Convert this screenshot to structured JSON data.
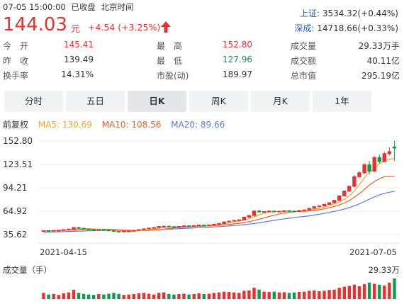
{
  "header": {
    "datetime": "07-05 15:00:00",
    "status": "已收盘",
    "timezone": "北京时间",
    "price": "144.03",
    "unit": "元",
    "change": "+4.54 (+3.25%)",
    "arrow": "up-arrow-icon"
  },
  "indices": [
    {
      "name": "上证:",
      "value": "3534.32(+0.44%)"
    },
    {
      "name": "深成:",
      "value": "14718.66(+0.33%)"
    }
  ],
  "stats": {
    "col1": [
      {
        "label": "今　开",
        "value": "145.41",
        "color": "red"
      },
      {
        "label": "昨　收",
        "value": "139.49",
        "color": "normal"
      },
      {
        "label": "换手率",
        "value": "14.31%",
        "color": "normal"
      }
    ],
    "col2": [
      {
        "label": "最　高",
        "value": "152.80",
        "color": "red"
      },
      {
        "label": "最　低",
        "value": "127.96",
        "color": "green"
      },
      {
        "label": "市盈(动)",
        "value": "189.97",
        "color": "normal"
      }
    ],
    "col3": [
      {
        "label": "成交量",
        "value": "29.33万手",
        "color": "normal"
      },
      {
        "label": "成交额",
        "value": "40.11亿",
        "color": "normal"
      },
      {
        "label": "总市值",
        "value": "295.19亿",
        "color": "normal"
      }
    ]
  },
  "tabs": [
    "分时",
    "五日",
    "日K",
    "周K",
    "月K",
    "1年"
  ],
  "active_tab": "日K",
  "legend": {
    "adjust": "前复权",
    "ma5": "MA5: 130.69",
    "ma10": "MA10: 108.56",
    "ma20": "MA20: 89.66"
  },
  "colors": {
    "up": "#e93030",
    "down": "#0a9d4f",
    "ma5": "#f5a623",
    "ma10": "#ee5d2a",
    "ma20": "#5b7be0"
  },
  "volume": {
    "label": "成交量（手）",
    "max_label": "29.33万"
  },
  "chart_data": {
    "type": "candlestick",
    "y_ticks": [
      "152.80",
      "123.51",
      "94.21",
      "64.92",
      "35.62"
    ],
    "ylim": [
      35.62,
      152.8
    ],
    "x_labels": [
      "2021-04-15",
      "2021-07-05"
    ],
    "candles": [
      [
        40,
        41,
        39,
        40.5
      ],
      [
        40.5,
        41,
        40,
        40.2
      ],
      [
        40.2,
        41,
        40,
        40.8
      ],
      [
        40.8,
        41.5,
        40.5,
        41
      ],
      [
        41,
        42,
        40.8,
        41.8
      ],
      [
        41.8,
        43,
        41.5,
        42.5
      ],
      [
        42.5,
        45,
        42,
        44.5
      ],
      [
        44.5,
        45,
        43,
        43.5
      ],
      [
        43.5,
        44,
        42,
        42.5
      ],
      [
        42.5,
        43,
        41.5,
        42
      ],
      [
        42,
        42.5,
        41,
        41.5
      ],
      [
        41.5,
        42,
        41,
        41.8
      ],
      [
        41.8,
        42,
        41,
        41.2
      ],
      [
        41.2,
        41.5,
        40,
        40.5
      ],
      [
        40.5,
        41,
        39,
        39.5
      ],
      [
        39.5,
        40,
        38.5,
        39
      ],
      [
        39,
        40,
        38.5,
        39.8
      ],
      [
        39.8,
        40.5,
        39,
        40
      ],
      [
        40,
        41,
        39.5,
        40.8
      ],
      [
        40.8,
        42,
        40.5,
        41.8
      ],
      [
        41.8,
        43,
        41.5,
        42.8
      ],
      [
        42.8,
        44,
        42.5,
        43.8
      ],
      [
        43.8,
        45,
        43.5,
        44.5
      ],
      [
        44.5,
        46,
        44,
        45.8
      ],
      [
        45.8,
        47,
        45,
        46
      ],
      [
        46,
        47,
        45,
        45.5
      ],
      [
        45.5,
        46,
        44.5,
        45
      ],
      [
        45,
        46,
        44.5,
        45.8
      ],
      [
        45.8,
        47,
        45.5,
        46.5
      ],
      [
        46.5,
        47,
        45.5,
        46
      ],
      [
        46,
        47,
        45.5,
        46.8
      ],
      [
        46.8,
        48,
        46.5,
        47.5
      ],
      [
        47.5,
        48,
        46.5,
        47
      ],
      [
        47,
        48,
        46.5,
        47.8
      ],
      [
        47.8,
        49,
        47.5,
        48.5
      ],
      [
        48.5,
        50,
        48,
        49.5
      ],
      [
        49.5,
        52,
        49,
        51.5
      ],
      [
        51.5,
        53,
        51,
        52.5
      ],
      [
        52.5,
        54,
        52,
        53.5
      ],
      [
        53.5,
        55,
        53,
        54
      ],
      [
        54,
        58,
        53.5,
        57.5
      ],
      [
        57.5,
        60,
        57,
        59.5
      ],
      [
        59.5,
        66,
        59,
        65
      ],
      [
        65,
        67,
        63,
        64
      ],
      [
        64,
        65,
        63,
        64.5
      ],
      [
        64.5,
        66,
        64,
        65
      ],
      [
        65,
        65.5,
        63.5,
        64
      ],
      [
        64,
        65,
        63.5,
        64.8
      ],
      [
        64.8,
        66,
        64,
        65.5
      ],
      [
        65.5,
        66,
        64.5,
        65
      ],
      [
        65,
        65.5,
        64,
        64.5
      ],
      [
        64.5,
        66,
        64,
        65.8
      ],
      [
        65.8,
        67,
        65,
        66.5
      ],
      [
        66.5,
        69,
        66,
        68.5
      ],
      [
        68.5,
        71,
        68,
        70.5
      ],
      [
        70.5,
        72,
        70,
        71.5
      ],
      [
        71.5,
        74,
        71,
        73.5
      ],
      [
        73.5,
        76,
        73,
        75.5
      ],
      [
        75.5,
        79,
        75,
        78.5
      ],
      [
        78.5,
        85,
        78,
        84
      ],
      [
        84,
        91,
        83.5,
        90
      ],
      [
        90,
        97,
        89,
        96
      ],
      [
        96,
        110,
        95,
        108
      ],
      [
        108,
        115,
        106,
        113
      ],
      [
        113,
        125,
        111,
        123
      ],
      [
        123,
        128,
        112,
        115
      ],
      [
        115,
        134,
        114,
        132
      ],
      [
        132,
        136,
        125,
        127
      ],
      [
        127,
        139,
        126,
        137
      ],
      [
        137,
        145,
        135,
        139.5
      ],
      [
        145.41,
        152.8,
        127.96,
        144.03
      ]
    ],
    "ma5": [
      40.3,
      40.4,
      40.5,
      40.7,
      40.9,
      41.4,
      42.1,
      42.6,
      43.0,
      43.0,
      42.7,
      42.3,
      41.8,
      41.4,
      40.9,
      40.4,
      40.0,
      39.8,
      39.8,
      40.2,
      41.0,
      41.8,
      42.6,
      43.5,
      44.5,
      45.1,
      45.4,
      45.6,
      45.8,
      45.9,
      46.2,
      46.5,
      46.8,
      47.0,
      47.4,
      48.1,
      49.1,
      50.2,
      51.3,
      52.3,
      53.6,
      55.5,
      57.8,
      60.2,
      62.2,
      63.8,
      64.7,
      64.6,
      64.8,
      64.8,
      64.6,
      64.9,
      65.5,
      66.1,
      67.2,
      68.5,
      70.0,
      72.0,
      74.1,
      76.6,
      79.7,
      84.4,
      90.1,
      98.3,
      106.5,
      113.8,
      118.2,
      124.4,
      127.8,
      130.2,
      130.69
    ],
    "ma10": [
      40.4,
      40.4,
      40.5,
      40.6,
      40.8,
      41.0,
      41.3,
      41.6,
      41.9,
      42.1,
      42.3,
      42.3,
      42.3,
      42.2,
      41.9,
      41.6,
      41.3,
      41.0,
      40.8,
      40.6,
      40.7,
      40.8,
      41.2,
      41.7,
      42.4,
      43.2,
      43.8,
      44.3,
      44.8,
      45.2,
      45.6,
      45.9,
      46.2,
      46.5,
      46.8,
      47.2,
      47.7,
      48.3,
      49.0,
      49.7,
      50.6,
      51.8,
      53.2,
      54.8,
      56.5,
      58.3,
      59.9,
      61.3,
      62.6,
      63.6,
      64.2,
      64.5,
      64.8,
      65.2,
      65.8,
      66.7,
      67.8,
      69.2,
      70.8,
      72.7,
      75.1,
      78.2,
      82.2,
      86.9,
      92.1,
      97.6,
      102.0,
      105.5,
      108.2,
      108.4,
      108.56
    ],
    "ma20": [
      38.5,
      38.7,
      38.9,
      39.1,
      39.3,
      39.5,
      39.7,
      39.9,
      40.1,
      40.3,
      40.5,
      40.7,
      40.9,
      41.0,
      41.0,
      40.9,
      40.8,
      40.8,
      40.8,
      40.9,
      41.1,
      41.3,
      41.5,
      41.8,
      42.1,
      42.4,
      42.7,
      43.0,
      43.3,
      43.6,
      44.0,
      44.3,
      44.6,
      44.9,
      45.2,
      45.6,
      46.0,
      46.4,
      46.9,
      47.4,
      48.0,
      48.7,
      49.5,
      50.4,
      51.4,
      52.4,
      53.4,
      54.4,
      55.3,
      56.1,
      56.9,
      57.6,
      58.3,
      59.1,
      60.0,
      61.0,
      62.1,
      63.3,
      64.6,
      66.0,
      67.6,
      69.5,
      71.6,
      74.1,
      76.9,
      79.9,
      82.7,
      85.2,
      87.3,
      88.6,
      89.66
    ],
    "volumes": [
      0.3,
      0.22,
      0.25,
      0.2,
      0.28,
      0.32,
      0.45,
      0.3,
      0.25,
      0.22,
      0.2,
      0.24,
      0.22,
      0.26,
      0.3,
      0.25,
      0.2,
      0.22,
      0.24,
      0.28,
      0.3,
      0.26,
      0.22,
      0.3,
      0.32,
      0.25,
      0.22,
      0.24,
      0.26,
      0.22,
      0.25,
      0.28,
      0.24,
      0.26,
      0.3,
      0.32,
      0.36,
      0.34,
      0.32,
      0.3,
      0.4,
      0.42,
      0.55,
      0.46,
      0.36,
      0.34,
      0.36,
      0.32,
      0.33,
      0.3,
      0.32,
      0.34,
      0.36,
      0.4,
      0.42,
      0.38,
      0.4,
      0.44,
      0.46,
      0.55,
      0.6,
      0.64,
      0.7,
      0.62,
      0.72,
      0.8,
      0.74,
      0.7,
      0.66,
      0.8,
      1.0
    ]
  }
}
